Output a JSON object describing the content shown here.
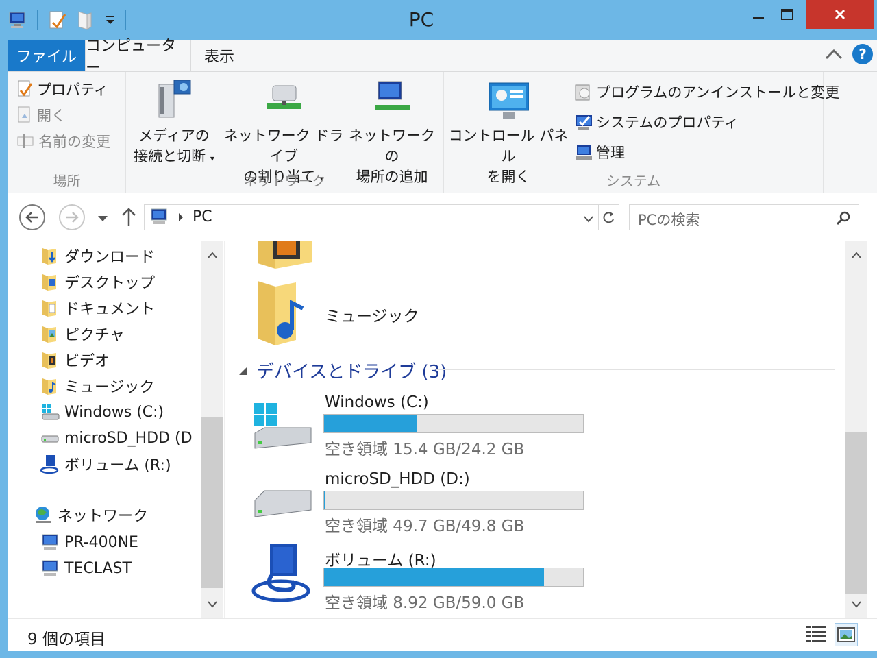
{
  "window": {
    "title": "PC"
  },
  "tabs": {
    "file": "ファイル",
    "computer": "コンピューター",
    "view": "表示"
  },
  "ribbon": {
    "location": {
      "label": "場所",
      "properties": "プロパティ",
      "open": "開く",
      "rename": "名前の変更"
    },
    "network": {
      "label": "ネットワーク",
      "media_line1": "メディアの",
      "media_line2": "接続と切断",
      "map_line1": "ネットワーク ドライブ",
      "map_line2": "の割り当て",
      "add_line1": "ネットワークの",
      "add_line2": "場所の追加"
    },
    "system": {
      "label": "システム",
      "cp_line1": "コントロール パネル",
      "cp_line2": "を開く",
      "uninstall": "プログラムのアンインストールと変更",
      "sysprops": "システムのプロパティ",
      "manage": "管理"
    }
  },
  "address": {
    "crumb": "PC",
    "search_placeholder": "PCの検索"
  },
  "nav_pane": {
    "items": [
      "ダウンロード",
      "デスクトップ",
      "ドキュメント",
      "ピクチャ",
      "ビデオ",
      "ミュージック",
      "Windows (C:)",
      "microSD_HDD (D",
      "ボリューム (R:)"
    ],
    "network": "ネットワーク",
    "network_items": [
      "PR-400NE",
      "TECLAST"
    ]
  },
  "content": {
    "folders": {
      "music": "ミュージック"
    },
    "section": {
      "title": "デバイスとドライブ (3)"
    },
    "drives": [
      {
        "name": "Windows (C:)",
        "free": "空き領域 15.4 GB/24.2 GB",
        "used_fraction": 0.36
      },
      {
        "name": "microSD_HDD (D:)",
        "free": "空き領域 49.7 GB/49.8 GB",
        "used_fraction": 0.002
      },
      {
        "name": "ボリューム (R:)",
        "free": "空き領域 8.92 GB/59.0 GB",
        "used_fraction": 0.849
      }
    ]
  },
  "status": {
    "count": "9 個の項目"
  },
  "colors": {
    "accent": "#1979ca",
    "titlebar": "#6db7e6",
    "close": "#c7352c",
    "bar": "#26a0da",
    "section": "#1f3c99"
  }
}
